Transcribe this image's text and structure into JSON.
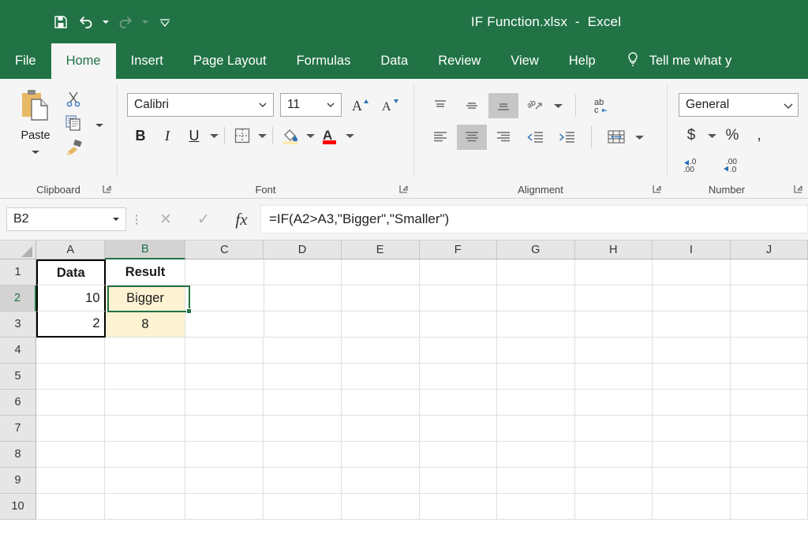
{
  "window": {
    "title": "IF Function.xlsx  -  Excel",
    "accent_color": "#217346"
  },
  "quick_access": {
    "save_label": "Save",
    "undo_label": "Undo",
    "redo_label": "Redo",
    "customize_label": "Customize Quick Access Toolbar"
  },
  "ribbon_tabs": [
    {
      "label": "File",
      "active": false
    },
    {
      "label": "Home",
      "active": true
    },
    {
      "label": "Insert",
      "active": false
    },
    {
      "label": "Page Layout",
      "active": false
    },
    {
      "label": "Formulas",
      "active": false
    },
    {
      "label": "Data",
      "active": false
    },
    {
      "label": "Review",
      "active": false
    },
    {
      "label": "View",
      "active": false
    },
    {
      "label": "Help",
      "active": false
    }
  ],
  "tell_me": {
    "label": "Tell me what y"
  },
  "ribbon": {
    "clipboard": {
      "label": "Clipboard",
      "paste_label": "Paste",
      "cut_label": "Cut",
      "copy_label": "Copy",
      "format_painter_label": "Format Painter"
    },
    "font": {
      "label": "Font",
      "font_name": "Calibri",
      "font_size": "11",
      "grow_font_label": "Increase Font Size",
      "shrink_font_label": "Decrease Font Size",
      "bold_label": "B",
      "italic_label": "I",
      "underline_label": "U",
      "borders_label": "Borders",
      "fill_color_label": "Fill Color",
      "fill_color": "#fce9b0",
      "font_color_label": "Font Color",
      "font_color": "#ff0000"
    },
    "alignment": {
      "label": "Alignment",
      "top_align_label": "Top Align",
      "middle_align_label": "Middle Align",
      "bottom_align_label": "Bottom Align",
      "orientation_label": "Orientation",
      "wrap_text_label": "Wrap Text",
      "align_left_label": "Align Left",
      "center_label": "Center",
      "align_right_label": "Align Right",
      "decrease_indent_label": "Decrease Indent",
      "increase_indent_label": "Increase Indent",
      "merge_center_label": "Merge & Center"
    },
    "number": {
      "label": "Number",
      "format": "General",
      "currency_label": "$",
      "percent_label": "%",
      "comma_label": ",",
      "increase_decimal_label": "Increase Decimal",
      "decrease_decimal_label": "Decrease Decimal"
    }
  },
  "formula_bar": {
    "name_box": "B2",
    "cancel_label": "Cancel",
    "enter_label": "Enter",
    "insert_function_label": "fx",
    "formula": "=IF(A2>A3,\"Bigger\",\"Smaller\")"
  },
  "sheet": {
    "selected_cell": "B2",
    "columns": [
      "A",
      "B",
      "C",
      "D",
      "E",
      "F",
      "G",
      "H",
      "I",
      "J"
    ],
    "rows": [
      "1",
      "2",
      "3",
      "4",
      "5",
      "6",
      "7",
      "8",
      "9",
      "10"
    ],
    "cells": {
      "A1": "Data",
      "B1": "Result",
      "A2": "10",
      "B2": "Bigger",
      "A3": "2",
      "B3": "8"
    },
    "fill_color": "#fdf3d3",
    "selection_color": "#217346"
  }
}
